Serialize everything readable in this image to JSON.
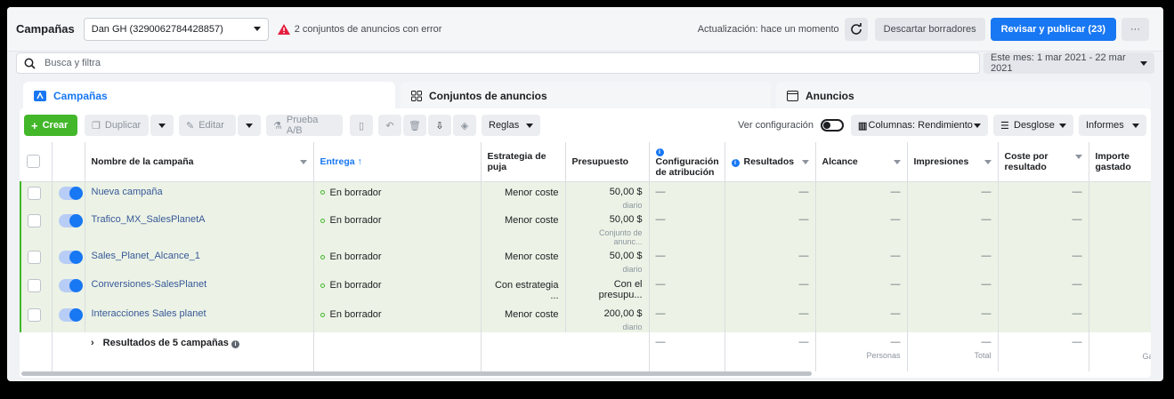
{
  "header": {
    "title": "Campañas",
    "account": "Dan GH (3290062784428857)",
    "error_text": "2 conjuntos de anuncios con error",
    "update_text": "Actualización: hace un momento",
    "discard_label": "Descartar borradores",
    "publish_label": "Revisar y publicar (23)",
    "more_label": "···"
  },
  "search": {
    "placeholder": "Busca y filtra",
    "date_range": "Este mes: 1 mar 2021 - 22 mar 2021"
  },
  "tabs": [
    {
      "label": "Campañas"
    },
    {
      "label": "Conjuntos de anuncios"
    },
    {
      "label": "Anuncios"
    }
  ],
  "toolbar": {
    "create": "Crear",
    "duplicate": "Duplicar",
    "edit": "Editar",
    "ab_test": "Prueba A/B",
    "rules": "Reglas",
    "view_config": "Ver configuración",
    "columns": "Columnas: Rendimiento",
    "breakdown": "Desglose",
    "reports": "Informes"
  },
  "columns": {
    "name": "Nombre de la campaña",
    "delivery": "Entrega ↑",
    "bid": "Estrategia de puja",
    "budget": "Presupuesto",
    "attribution": "Configuración de atribución",
    "results": "Resultados",
    "reach": "Alcance",
    "impressions": "Impresiones",
    "cost": "Coste por resultado",
    "spent": "Importe gastado"
  },
  "rows": [
    {
      "name": "Nueva campaña",
      "delivery": "En borrador",
      "bid": "Menor coste",
      "budget": "50,00 $",
      "budget_sub": "diario"
    },
    {
      "name": "Trafico_MX_SalesPlanetA",
      "delivery": "En borrador",
      "bid": "Menor coste",
      "budget": "50,00 $",
      "budget_sub": "Conjunto de anunc..."
    },
    {
      "name": "Sales_Planet_Alcance_1",
      "delivery": "En borrador",
      "bid": "Menor coste",
      "budget": "50,00 $",
      "budget_sub": "diario"
    },
    {
      "name": "Conversiones-SalesPlanet",
      "delivery": "En borrador",
      "bid": "Con estrategia ...",
      "budget": "Con el presupu...",
      "budget_sub": ""
    },
    {
      "name": "Interacciones Sales planet",
      "delivery": "En borrador",
      "bid": "Menor coste",
      "budget": "200,00 $",
      "budget_sub": "diario"
    }
  ],
  "summary": {
    "label": "Resultados de 5 campañas",
    "dash": "—",
    "reach_sub": "Personas",
    "impr_sub": "Total",
    "spent_sub": "Ga"
  },
  "dash": "—",
  "icon_colors": {
    "accent": "#1877f2",
    "create": "#42b72a",
    "warning": "#e41e3f"
  }
}
